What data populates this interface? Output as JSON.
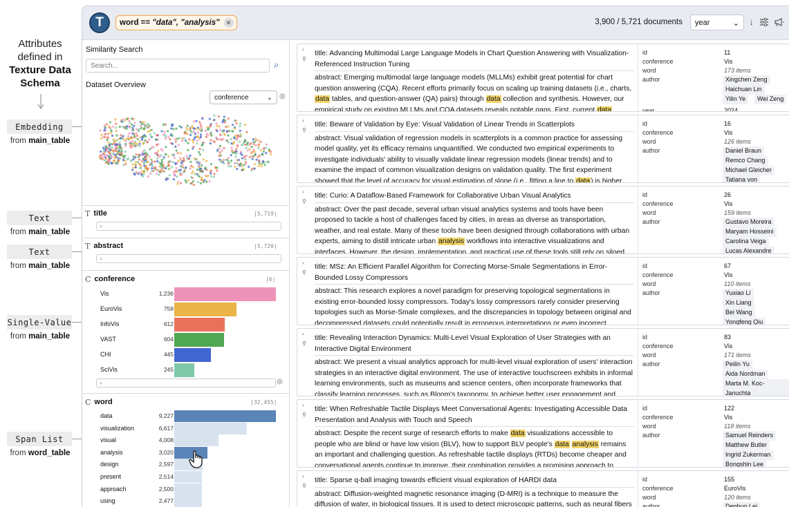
{
  "annotations": {
    "heading_lines": [
      "Attributes",
      "defined in"
    ],
    "heading_bold": [
      "Texture Data",
      "Schema"
    ],
    "items": [
      {
        "type": "Embedding",
        "source_prefix": "from ",
        "source": "main_table"
      },
      {
        "type": "Text",
        "source_prefix": "from ",
        "source": "main_table"
      },
      {
        "type": "Text",
        "source_prefix": "from ",
        "source": "main_table"
      },
      {
        "type": "Single-Value",
        "source_prefix": "from ",
        "source": "main_table"
      },
      {
        "type": "Span List",
        "source_prefix": "from ",
        "source": "word_table"
      }
    ]
  },
  "topbar": {
    "logo_letter": "T",
    "filter_prefix": "word == ",
    "filter_values": "\"data\", \"analysis\"",
    "filter_clear_icon": "close-icon",
    "doc_count": "3,900 / 5,721 documents",
    "sort_value": "year",
    "icons": [
      "sort-desc-icon",
      "settings-sliders-icon",
      "megaphone-icon"
    ]
  },
  "left": {
    "similarity_label": "Similarity Search",
    "search_placeholder": "Search...",
    "overview_label": "Dataset Overview",
    "color_by": "conference",
    "columns": [
      {
        "type_icon": "T",
        "name": "title",
        "count": "|5,719|"
      },
      {
        "type_icon": "T",
        "name": "abstract",
        "count": "|5,720|"
      },
      {
        "type_icon": "C",
        "name": "conference",
        "count": "|6|"
      },
      {
        "type_icon": "C",
        "name": "word",
        "count": "|32,455|"
      }
    ],
    "conference_bars": [
      {
        "label": "Vis",
        "value": 1236,
        "display": "1,236",
        "color": "#ee93b8"
      },
      {
        "label": "EuroVis",
        "value": 758,
        "display": "758",
        "color": "#ebb447"
      },
      {
        "label": "InfoVis",
        "value": 612,
        "display": "612",
        "color": "#ea7159"
      },
      {
        "label": "VAST",
        "value": 604,
        "display": "604",
        "color": "#4fa653"
      },
      {
        "label": "CHI",
        "value": 445,
        "display": "445",
        "color": "#4066cf"
      },
      {
        "label": "SciVis",
        "value": 245,
        "display": "245",
        "color": "#7ec8a9"
      }
    ],
    "word_bars": [
      {
        "label": "data",
        "value": 9227,
        "display": "9,227",
        "selected": true
      },
      {
        "label": "visualization",
        "value": 6617,
        "display": "6,617",
        "selected": false
      },
      {
        "label": "visual",
        "value": 4008,
        "display": "4,008",
        "selected": false
      },
      {
        "label": "analysis",
        "value": 3020,
        "display": "3,020",
        "selected": true
      },
      {
        "label": "design",
        "value": 2597,
        "display": "2,597",
        "selected": false
      },
      {
        "label": "present",
        "value": 2514,
        "display": "2,514",
        "selected": false
      },
      {
        "label": "approach",
        "value": 2500,
        "display": "2,500",
        "selected": false
      },
      {
        "label": "using",
        "value": 2477,
        "display": "2,477",
        "selected": false
      }
    ]
  },
  "meta_keys": {
    "id": "id",
    "conference": "conference",
    "word": "word",
    "author": "author",
    "year": "year"
  },
  "docs": [
    {
      "title": "Advancing Multimodal Large Language Models in Chart Question Answering with Visualization-Referenced Instruction Tuning",
      "abstract": "Emerging multimodal large language models (MLLMs) exhibit great potential for chart question answering (CQA). Recent efforts primarily focus on scaling up training datasets (i.e., charts, [[data]] tables, and question-answer (QA) pairs) through [[data]] collection and synthesis. However, our empirical study on existing MLLMs and CQA datasets reveals notable gaps. First, current [[data]]",
      "id": "11",
      "conference": "Vis",
      "word": "173 items",
      "authors": [
        "Xingchen Zeng",
        "Haichuan Lin",
        "Yilin Ye",
        "Wei Zeng"
      ],
      "year": "2024"
    },
    {
      "title": "Beware of Validation by Eye: Visual Validation of Linear Trends in Scatterplots",
      "abstract": "Visual validation of regression models in scatterplots is a common practice for assessing model quality, yet its efficacy remains unquantified. We conducted two empirical experiments to investigate individuals' ability to visually validate linear regression models (linear trends) and to examine the impact of common visualization designs on validation quality. The first experiment showed that the level of accuracy for visual estimation of slope (i.e., fitting a line to [[data]]) is higher",
      "id": "16",
      "conference": "Vis",
      "word": "126 items",
      "authors": [
        "Daniel Braun",
        "Remco Chang",
        "Michael Gleicher",
        "Tatiana von"
      ]
    },
    {
      "title": "Curio: A Dataflow-Based Framework for Collaborative Urban Visual Analytics",
      "abstract": "Over the past decade, several urban visual analytics systems and tools have been proposed to tackle a host of challenges faced by cities, in areas as diverse as transportation, weather, and real estate. Many of these tools have been designed through collaborations with urban experts, aiming to distill intricate urban [[analysis]] workflows into interactive visualizations and interfaces. However, the design, implementation, and practical use of these tools still rely on siloed approaches, resulting in",
      "id": "26",
      "conference": "Vis",
      "word": "159 items",
      "authors": [
        "Gustavo Moreira",
        "Maryam Hosseini",
        "Carolina Veiga",
        "Lucas Alexandre"
      ]
    },
    {
      "title": "MSz: An Efficient Parallel Algorithm for Correcting Morse-Smale Segmentations in Error-Bounded Lossy Compressors",
      "abstract": "This research explores a novel paradigm for preserving topological segmentations in existing error-bounded lossy compressors. Today's lossy compressors rarely consider preserving topologies such as Morse-Smale complexes, and the discrepancies in topology between original and decompressed datasets could potentially result in erroneous interpretations or even incorrect",
      "id": "67",
      "conference": "Vis",
      "word": "110 items",
      "authors": [
        "Yuxiao Li",
        "Xin Liang",
        "Bei Wang",
        "Yongfeng Qiu"
      ]
    },
    {
      "title": "Revealing Interaction Dynamics: Multi-Level Visual Exploration of User Strategies with an Interactive Digital Environment",
      "abstract": "We present a visual analytics approach for multi-level visual exploration of users' interaction strategies in an interactive digital environment. The use of interactive touchscreen exhibits in informal learning environments, such as museums and science centers, often incorporate frameworks that classify learning processes, such as Bloom's taxonomy, to achieve better user engagement and",
      "id": "83",
      "conference": "Vis",
      "word": "171 items",
      "authors": [
        "Peilin Yu",
        "Aida Nordman",
        "Marta M. Koc-Januchta"
      ]
    },
    {
      "title": "When Refreshable Tactile Displays Meet Conversational Agents: Investigating Accessible Data Presentation and Analysis with Touch and Speech",
      "abstract": "Despite the recent surge of research efforts to make [[data]] visualizations accessible to people who are blind or have low vision (BLV), how to support BLV people's [[data]] [[analysis]] remains an important and challenging question. As refreshable tactile displays (RTDs) become cheaper and conversational agents continue to improve, their combination provides a promising approach to",
      "id": "122",
      "conference": "Vis",
      "word": "118 items",
      "authors": [
        "Samuel Reinders",
        "Matthew Butler",
        "Ingrid Zukerman",
        "Bongshin Lee"
      ]
    },
    {
      "title": "Sparse q-ball imaging towards efficient visual exploration of HARDI data",
      "abstract": "Diffusion-weighted magnetic resonance imaging (D-MRI) is a technique to measure the diffusion of water, in biological tissues. It is used to detect microscopic patterns, such as neural fibers",
      "id": "155",
      "conference": "EuroVis",
      "word": "120 items",
      "authors": [
        "Denhuo Lei"
      ]
    }
  ],
  "labels": {
    "title_prefix": "title: ",
    "abstract_prefix": "abstract: "
  }
}
